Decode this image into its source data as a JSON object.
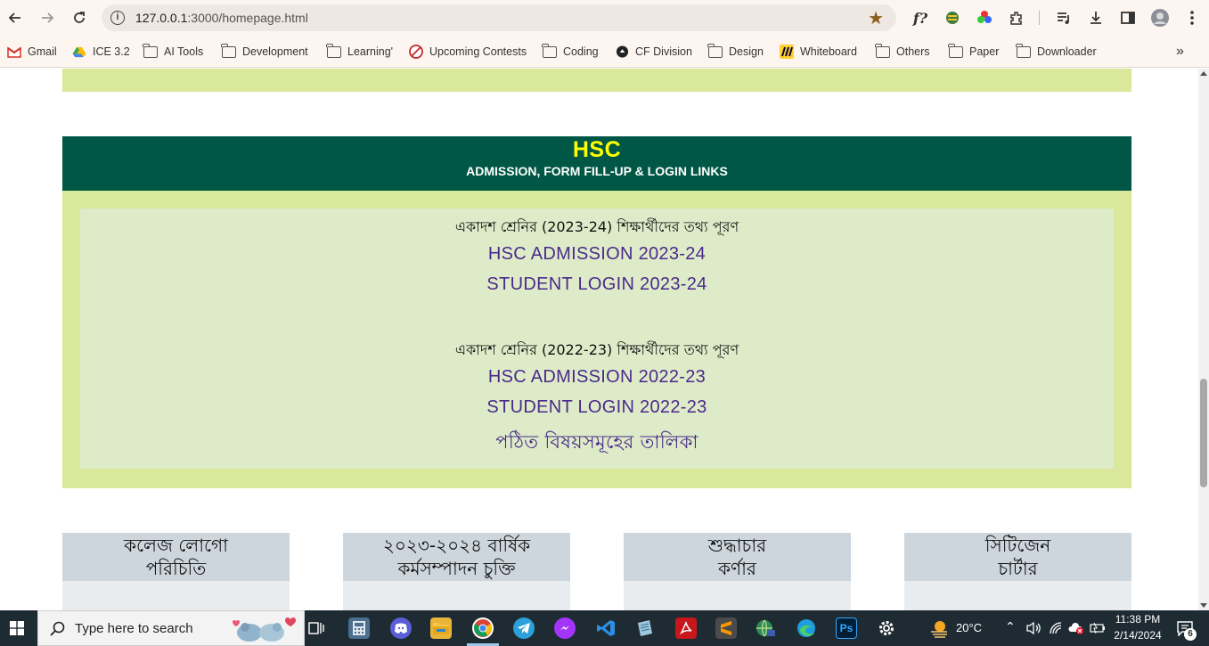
{
  "browser": {
    "url_host": "127.0.0.1",
    "url_rest": ":3000/homepage.html"
  },
  "bookmarks": [
    {
      "label": "Gmail",
      "icon": "gmail-icon"
    },
    {
      "label": "ICE 3.2",
      "icon": "drive-icon"
    },
    {
      "label": "AI Tools",
      "icon": "folder-icon"
    },
    {
      "label": "Development",
      "icon": "folder-icon"
    },
    {
      "label": "Learning'",
      "icon": "folder-icon"
    },
    {
      "label": "Upcoming Contests",
      "icon": "contest-icon"
    },
    {
      "label": "Coding",
      "icon": "folder-icon"
    },
    {
      "label": "CF Division",
      "icon": "cf-icon"
    },
    {
      "label": "Design",
      "icon": "folder-icon"
    },
    {
      "label": "Whiteboard",
      "icon": "miro-icon"
    },
    {
      "label": "Others",
      "icon": "folder-icon"
    },
    {
      "label": "Paper",
      "icon": "folder-icon"
    },
    {
      "label": "Downloader",
      "icon": "folder-icon"
    }
  ],
  "hsc": {
    "title": "HSC",
    "subtitle": "ADMISSION, FORM FILL-UP & LOGIN LINKS",
    "label_2023": "একাদশ শ্রেনির (2023-24) শিক্ষার্থীদের তথ্য পূরণ",
    "admission_2023": "HSC ADMISSION 2023-24",
    "login_2023": "STUDENT LOGIN 2023-24",
    "label_2022": "একাদশ শ্রেনির (2022-23) শিক্ষার্থীদের তথ্য পূরণ",
    "admission_2022": "HSC ADMISSION 2022-23",
    "login_2022": "STUDENT LOGIN 2022-23",
    "subjects": "পঠিত বিষয়সমূহের তালিকা"
  },
  "cards": [
    {
      "line1": "কলেজ লোগো",
      "line2": "পরিচিতি"
    },
    {
      "line1": "২০২৩-২০২৪ বার্ষিক",
      "line2": "কর্মসম্পাদন চুক্তি"
    },
    {
      "line1": "শুদ্ধাচার",
      "line2": "কর্ণার"
    },
    {
      "line1": "সিটিজেন",
      "line2": "চার্টার"
    }
  ],
  "taskbar": {
    "search_placeholder": "Type here to search",
    "weather": "20°C",
    "time": "11:38 PM",
    "date": "2/14/2024",
    "notifications": "6"
  }
}
